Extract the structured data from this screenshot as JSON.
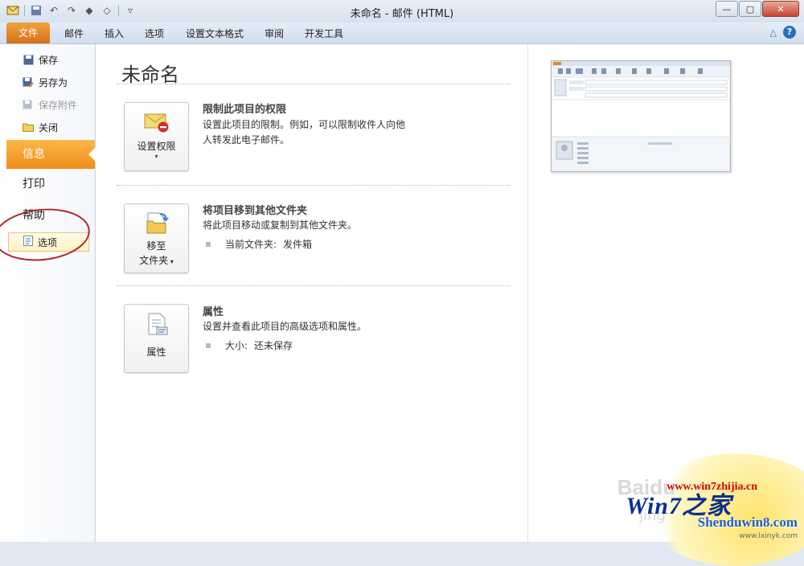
{
  "window": {
    "title": "未命名 - 邮件 (HTML)"
  },
  "ribbon": {
    "file_tab": "文件",
    "tabs": [
      "邮件",
      "插入",
      "选项",
      "设置文本格式",
      "审阅",
      "开发工具"
    ]
  },
  "backstage": {
    "commands": {
      "save": "保存",
      "save_as": "另存为",
      "save_attachments": "保存附件",
      "close": "关闭"
    },
    "nav": {
      "info": "信息",
      "print": "打印",
      "help": "帮助",
      "options": "选项"
    }
  },
  "info": {
    "title": "未命名",
    "permissions": {
      "button": "设置权限",
      "heading": "限制此项目的权限",
      "description": "设置此项目的限制。例如，可以限制收件人向他人转发此电子邮件。"
    },
    "move": {
      "button_line1": "移至",
      "button_line2": "文件夹",
      "heading": "将项目移到其他文件夹",
      "description": "将此项目移动或复制到其他文件夹。",
      "current_folder_label": "当前文件夹:",
      "current_folder_value": "发件箱"
    },
    "properties": {
      "button": "属性",
      "heading": "属性",
      "description": "设置并查看此项目的高级选项和属性。",
      "size_label": "大小:",
      "size_value": "还未保存"
    }
  },
  "watermark": {
    "baidu": "Baidu",
    "jing": "jing",
    "url1": "www.win7zhijia.cn",
    "win_logo": "Win7之家",
    "url2": "Shenduwin8.com",
    "url3": "www.lxinyk.com"
  },
  "colors": {
    "file_tab": "#e2801f",
    "active_nav": "#f39a22",
    "annotation_circle": "#b2232c"
  }
}
